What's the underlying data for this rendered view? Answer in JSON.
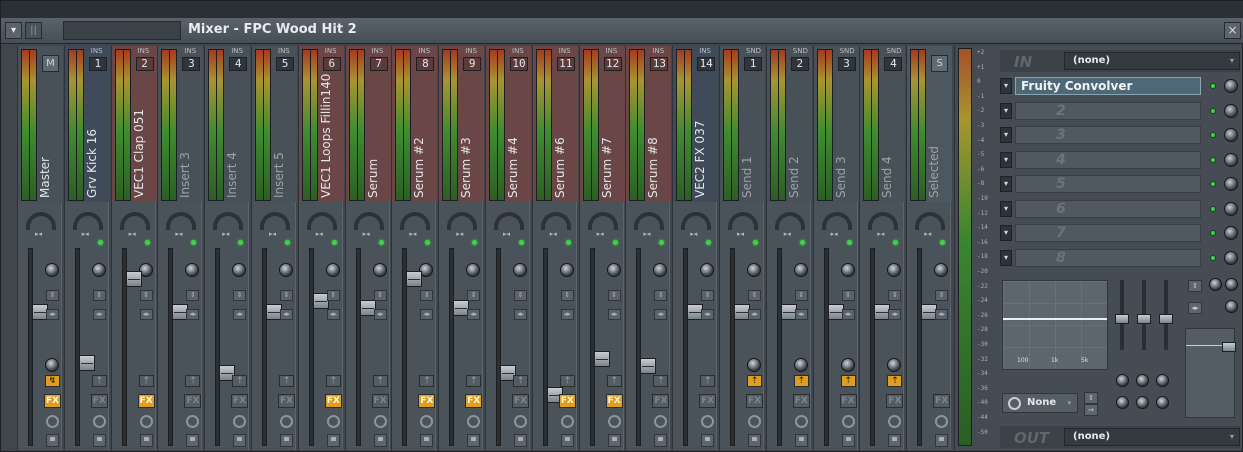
{
  "window": {
    "title": "Mixer - FPC Wood Hit 2",
    "close_label": "×",
    "menu_label": "▾",
    "grip_label": "||"
  },
  "strips": [
    {
      "name": "Master",
      "type": "",
      "num": "M",
      "kind": "master",
      "fader": 0.7,
      "fx": false
    },
    {
      "name": "Grv Kick 16",
      "type": "INS",
      "num": "1",
      "kind": "blue",
      "fader": 0.42,
      "fx": false
    },
    {
      "name": "VEC1 Clap 051",
      "type": "INS",
      "num": "2",
      "kind": "red",
      "fader": 0.88,
      "fx": true
    },
    {
      "name": "Insert 3",
      "type": "INS",
      "num": "3",
      "kind": "dim",
      "fader": 0.7,
      "fx": false
    },
    {
      "name": "Insert 4",
      "type": "INS",
      "num": "4",
      "kind": "dim",
      "fader": 0.36,
      "fx": false
    },
    {
      "name": "Insert 5",
      "type": "INS",
      "num": "5",
      "kind": "dim",
      "fader": 0.7,
      "fx": false
    },
    {
      "name": "VEC1 Loops Fillin140",
      "type": "INS",
      "num": "6",
      "kind": "red",
      "fader": 0.76,
      "fx": true
    },
    {
      "name": "Serum",
      "type": "INS",
      "num": "7",
      "kind": "red",
      "fader": 0.72,
      "fx": false
    },
    {
      "name": "Serum #2",
      "type": "INS",
      "num": "8",
      "kind": "red",
      "fader": 0.88,
      "fx": true
    },
    {
      "name": "Serum #3",
      "type": "INS",
      "num": "9",
      "kind": "red",
      "fader": 0.72,
      "fx": true
    },
    {
      "name": "Serum #4",
      "type": "INS",
      "num": "10",
      "kind": "red",
      "fader": 0.36,
      "fx": false
    },
    {
      "name": "Serum #6",
      "type": "INS",
      "num": "11",
      "kind": "red",
      "fader": 0.24,
      "fx": true
    },
    {
      "name": "Serum #7",
      "type": "INS",
      "num": "12",
      "kind": "red",
      "fader": 0.44,
      "fx": true
    },
    {
      "name": "Serum #8",
      "type": "INS",
      "num": "13",
      "kind": "red",
      "fader": 0.4,
      "fx": false
    },
    {
      "name": "VEC2 FX 037",
      "type": "INS",
      "num": "14",
      "kind": "blue",
      "fader": 0.7,
      "fx": false
    },
    {
      "name": "Send 1",
      "type": "SND",
      "num": "1",
      "kind": "dim",
      "fader": 0.7,
      "fx": false
    },
    {
      "name": "Send 2",
      "type": "SND",
      "num": "2",
      "kind": "dim",
      "fader": 0.7,
      "fx": false
    },
    {
      "name": "Send 3",
      "type": "SND",
      "num": "3",
      "kind": "dim",
      "fader": 0.7,
      "fx": false
    },
    {
      "name": "Send 4",
      "type": "SND",
      "num": "4",
      "kind": "dim",
      "fader": 0.7,
      "fx": false
    },
    {
      "name": "Selected",
      "type": "",
      "num": "S",
      "kind": "selected",
      "fader": 0.7,
      "fx": false
    }
  ],
  "meter_scale": [
    "+2",
    "+1",
    "0",
    "-1",
    "-2",
    "-3",
    "-4",
    "-5",
    "-6",
    "-8",
    "-10",
    "-12",
    "-14",
    "-16",
    "-18",
    "-20",
    "-22",
    "-24",
    "-26",
    "-28",
    "-30",
    "-32",
    "-34",
    "-36",
    "-40",
    "-44",
    "-50"
  ],
  "panel": {
    "in_label": "IN",
    "in_value": "(none)",
    "out_label": "OUT",
    "out_value": "(none)",
    "slots": [
      {
        "num": "1",
        "name": "Fruity Convolver",
        "filled": true
      },
      {
        "num": "2",
        "name": "2",
        "filled": false
      },
      {
        "num": "3",
        "name": "3",
        "filled": false
      },
      {
        "num": "4",
        "name": "4",
        "filled": false
      },
      {
        "num": "5",
        "name": "5",
        "filled": false
      },
      {
        "num": "6",
        "name": "6",
        "filled": false
      },
      {
        "num": "7",
        "name": "7",
        "filled": false
      },
      {
        "num": "8",
        "name": "8",
        "filled": false
      }
    ],
    "eq_labels": [
      "100",
      "1k",
      "5k"
    ],
    "track_select": "None",
    "fx_label": "FX",
    "dropdown_arrow": "▾"
  }
}
